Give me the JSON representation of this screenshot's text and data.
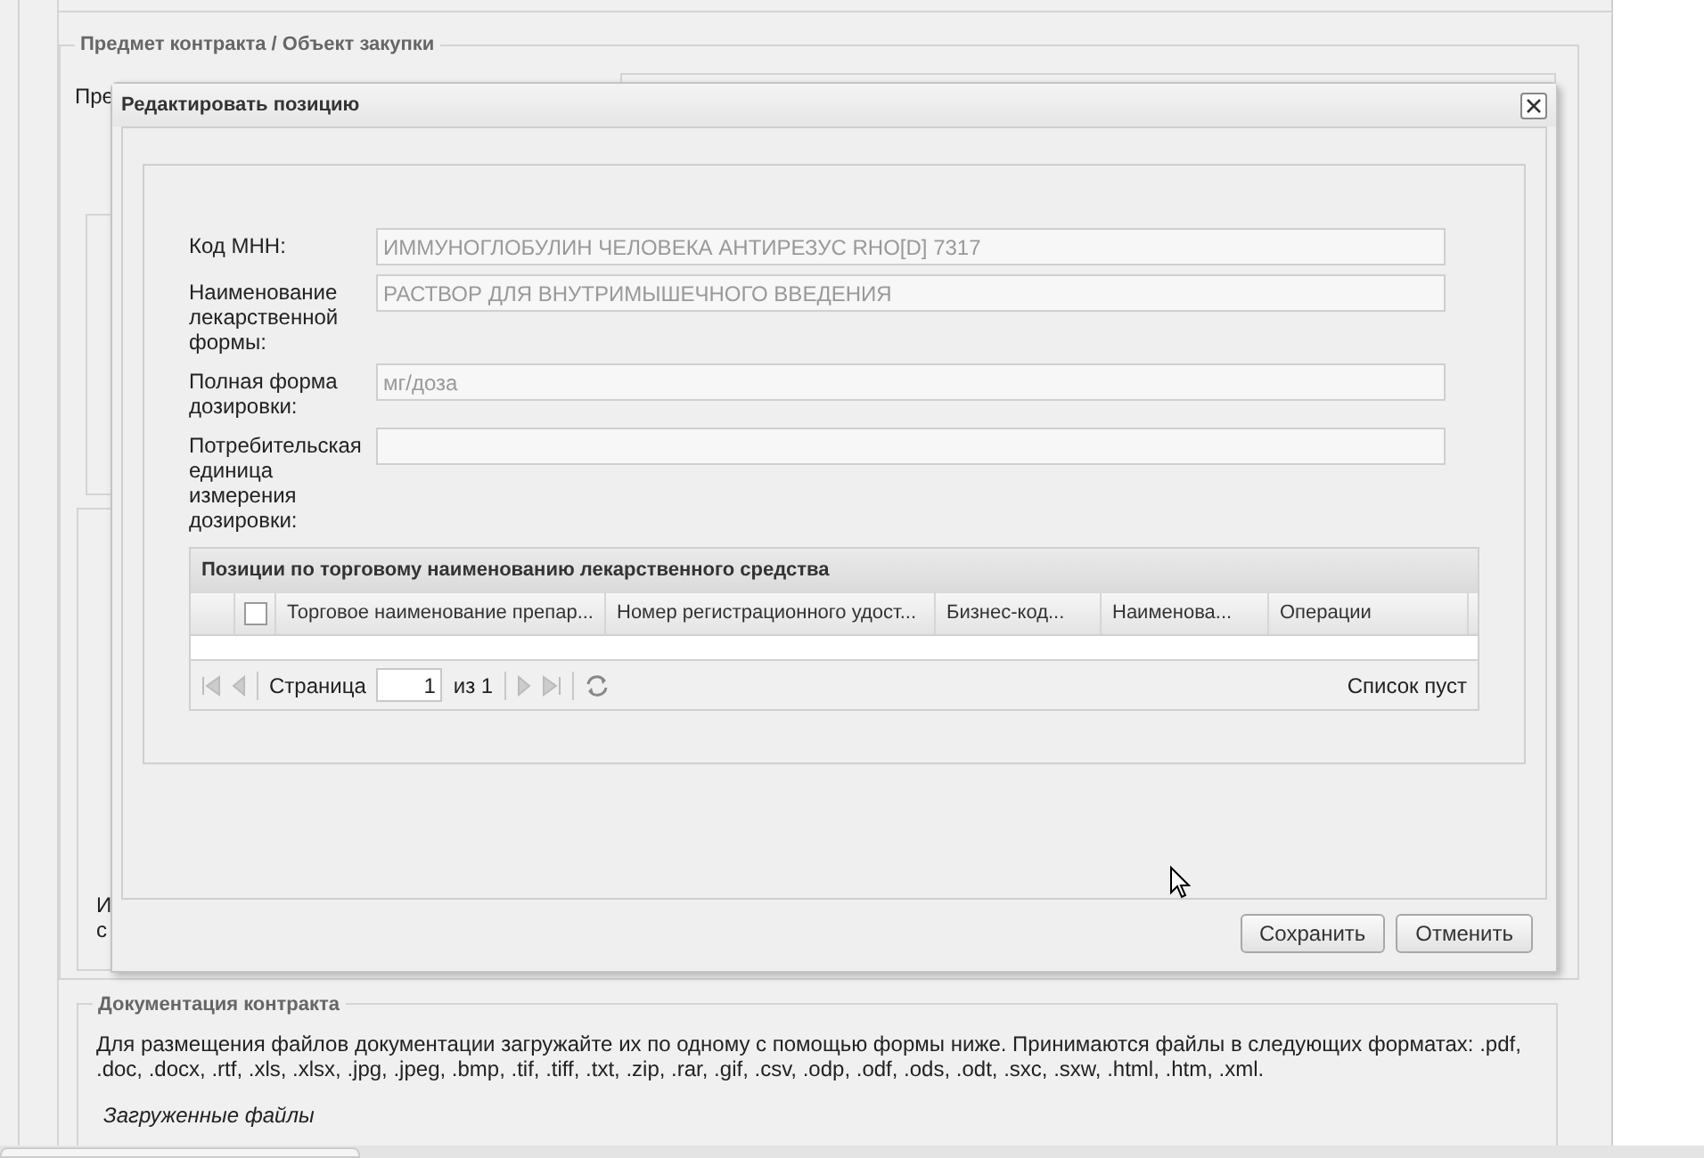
{
  "background": {
    "section_title": "Предмет контракта / Объект закупки",
    "fragments": [
      {
        "text": "Пре"
      },
      {
        "text": "И"
      },
      {
        "text": "с"
      }
    ],
    "documents": {
      "title": "Документация контракта",
      "text": "Для размещения файлов документации загружайте их по одному с помощью формы ниже. Принимаются файлы в следующих форматах: .pdf, .doc, .docx, .rtf, .xls, .xlsx, .jpg, .jpeg, .bmp, .tif, .tiff, .txt, .zip, .rar, .gif, .csv, .odp, .odf, .ods, .odt, .sxc, .sxw, .html, .htm, .xml.",
      "files_label": "Загруженные файлы"
    }
  },
  "dialog": {
    "title": "Редактировать позицию",
    "fields": [
      {
        "label": "Код МНН:",
        "value": "ИММУНОГЛОБУЛИН ЧЕЛОВЕКА АНТИРЕЗУС RHO[D] 7317"
      },
      {
        "label": "Наименование лекарственной формы:",
        "value": "РАСТВОР ДЛЯ ВНУТРИМЫШЕЧНОГО ВВЕДЕНИЯ"
      },
      {
        "label": "Полная форма дозировки:",
        "value": "мг/доза"
      },
      {
        "label": "Потребительская единица измерения дозировки:"
      }
    ],
    "grid": {
      "title": "Позиции по торговому наименованию лекарственного средства",
      "select_all_checked": false,
      "columns": [
        "Торговое наименование препар...",
        "Номер регистрационного удост...",
        "Бизнес-код...",
        "Наименова...",
        "Операции"
      ],
      "pager": {
        "page_label": "Страница",
        "page": "1",
        "of": "из 1",
        "status": "Список пуст"
      }
    },
    "buttons": [
      "Сохранить",
      "Отменить"
    ]
  }
}
